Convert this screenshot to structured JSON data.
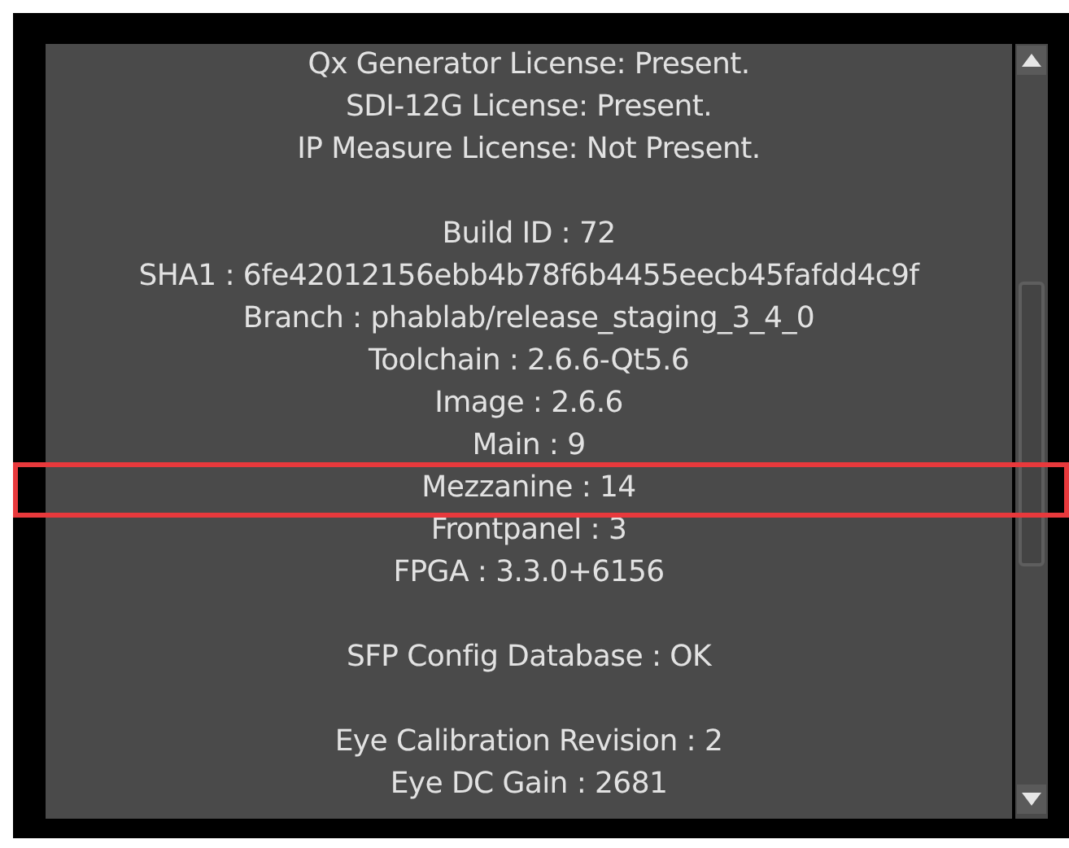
{
  "info_groups": [
    {
      "lines": [
        {
          "text": "Qx Generator License: Present.",
          "highlighted": false
        },
        {
          "text": "SDI-12G License: Present.",
          "highlighted": false
        },
        {
          "text": "IP Measure License: Not Present.",
          "highlighted": false
        }
      ]
    },
    {
      "lines": [
        {
          "text": "Build ID : 72",
          "highlighted": false
        },
        {
          "text": "SHA1 : 6fe42012156ebb4b78f6b4455eecb45fafdd4c9f",
          "highlighted": false
        },
        {
          "text": "Branch : phablab/release_staging_3_4_0",
          "highlighted": false
        },
        {
          "text": "Toolchain : 2.6.6-Qt5.6",
          "highlighted": false
        },
        {
          "text": "Image : 2.6.6",
          "highlighted": false
        },
        {
          "text": "Main : 9",
          "highlighted": false
        },
        {
          "text": "Mezzanine : 14",
          "highlighted": true
        },
        {
          "text": "Frontpanel : 3",
          "highlighted": false
        },
        {
          "text": "FPGA : 3.3.0+6156",
          "highlighted": false
        }
      ]
    },
    {
      "lines": [
        {
          "text": "SFP Config Database : OK",
          "highlighted": false
        }
      ]
    },
    {
      "lines": [
        {
          "text": "Eye Calibration Revision : 2",
          "highlighted": false
        },
        {
          "text": "Eye DC Gain : 2681",
          "highlighted": false
        }
      ]
    }
  ]
}
